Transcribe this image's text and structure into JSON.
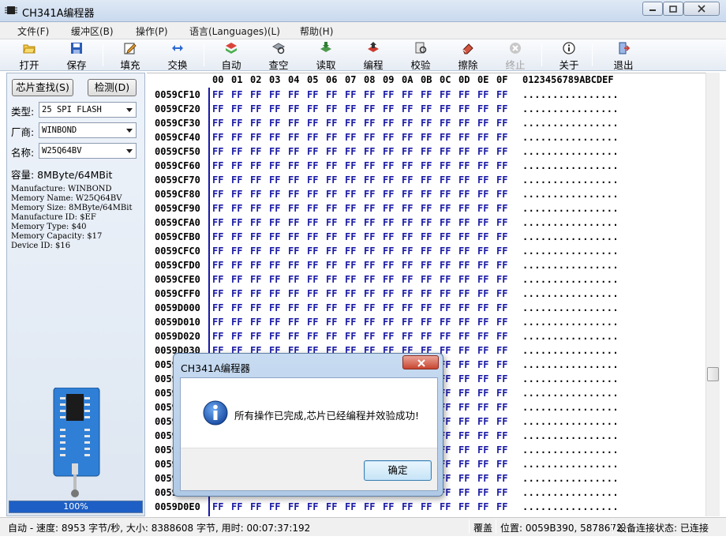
{
  "window": {
    "title": "CH341A编程器"
  },
  "menu": [
    "文件(F)",
    "缓冲区(B)",
    "操作(P)",
    "语言(Languages)(L)",
    "帮助(H)"
  ],
  "toolbar": {
    "open": "打开",
    "save": "保存",
    "fill": "填充",
    "swap": "交换",
    "auto": "自动",
    "blank_check": "查空",
    "read": "读取",
    "program": "编程",
    "verify": "校验",
    "erase": "擦除",
    "stop": "终止",
    "about": "关于",
    "exit": "退出"
  },
  "panel": {
    "detect_chip_button": "芯片查找(S)",
    "detect_button": "检测(D)",
    "type_label": "类型:",
    "type_value": "25 SPI FLASH",
    "vendor_label": "厂商:",
    "vendor_value": "WINBOND",
    "name_label": "名称:",
    "name_value": "W25Q64BV",
    "capacity": "容量: 8MByte/64MBit",
    "info_lines": [
      "Manufacture: WINBOND",
      "Memory Name: W25Q64BV",
      "Memory Size: 8MByte/64MBit",
      "Manufacture ID: $EF",
      "Memory Type: $40",
      "Memory Capacity: $17",
      "Device ID: $16"
    ],
    "progress_percent": 100,
    "progress_text": "100%"
  },
  "hex": {
    "header_columns": [
      "00",
      "01",
      "02",
      "03",
      "04",
      "05",
      "06",
      "07",
      "08",
      "09",
      "0A",
      "0B",
      "0C",
      "0D",
      "0E",
      "0F"
    ],
    "ascii_header": "0123456789ABCDEF",
    "rows": [
      "0059CF10",
      "0059CF20",
      "0059CF30",
      "0059CF40",
      "0059CF50",
      "0059CF60",
      "0059CF70",
      "0059CF80",
      "0059CF90",
      "0059CFA0",
      "0059CFB0",
      "0059CFC0",
      "0059CFD0",
      "0059CFE0",
      "0059CFF0",
      "0059D000",
      "0059D010",
      "0059D020",
      "0059D030",
      "0059D040",
      "0059D050",
      "0059D060",
      "0059D070",
      "0059D080",
      "0059D090",
      "0059D0A0",
      "0059D0B0",
      "0059D0C0",
      "0059D0D0",
      "0059D0E0"
    ],
    "byte_value": "FF",
    "ascii_row": "................",
    "byte_color": "#1a1aa6"
  },
  "statusbar": {
    "stats": "自动 - 速度: 8953 字节/秒, 大小: 8388608 字节, 用时: 00:07:37:192",
    "mode": "覆盖",
    "position": "位置: 0059B390, 5878672",
    "connection": "设备连接状态: 已连接"
  },
  "dialog": {
    "title": "CH341A编程器",
    "message": "所有操作已完成,芯片已经编程并效验成功!",
    "ok_button": "确定"
  }
}
